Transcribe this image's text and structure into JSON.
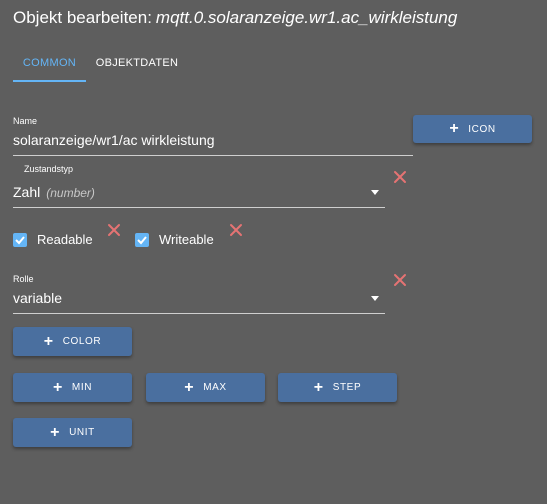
{
  "header": {
    "title_prefix": "Objekt bearbeiten:",
    "object_id": "mqtt.0.solaranzeige.wr1.ac_wirkleistung"
  },
  "tabs": [
    {
      "label": "COMMON",
      "active": true
    },
    {
      "label": "OBJEKTDATEN",
      "active": false
    }
  ],
  "form": {
    "name": {
      "label": "Name",
      "value": "solaranzeige/wr1/ac wirkleistung"
    },
    "icon_button": "ICON",
    "state_type": {
      "label": "Zustandstyp",
      "value": "Zahl",
      "hint": "(number)"
    },
    "readable": {
      "label": "Readable",
      "checked": true
    },
    "writeable": {
      "label": "Writeable",
      "checked": true
    },
    "role": {
      "label": "Rolle",
      "value": "variable"
    },
    "buttons": {
      "color": "COLOR",
      "min": "MIN",
      "max": "MAX",
      "step": "STEP",
      "unit": "UNIT"
    }
  },
  "colors": {
    "background": "#5e5e5e",
    "accent": "#64b5f6",
    "button": "#4a6f9f",
    "delete": "#e57373"
  }
}
